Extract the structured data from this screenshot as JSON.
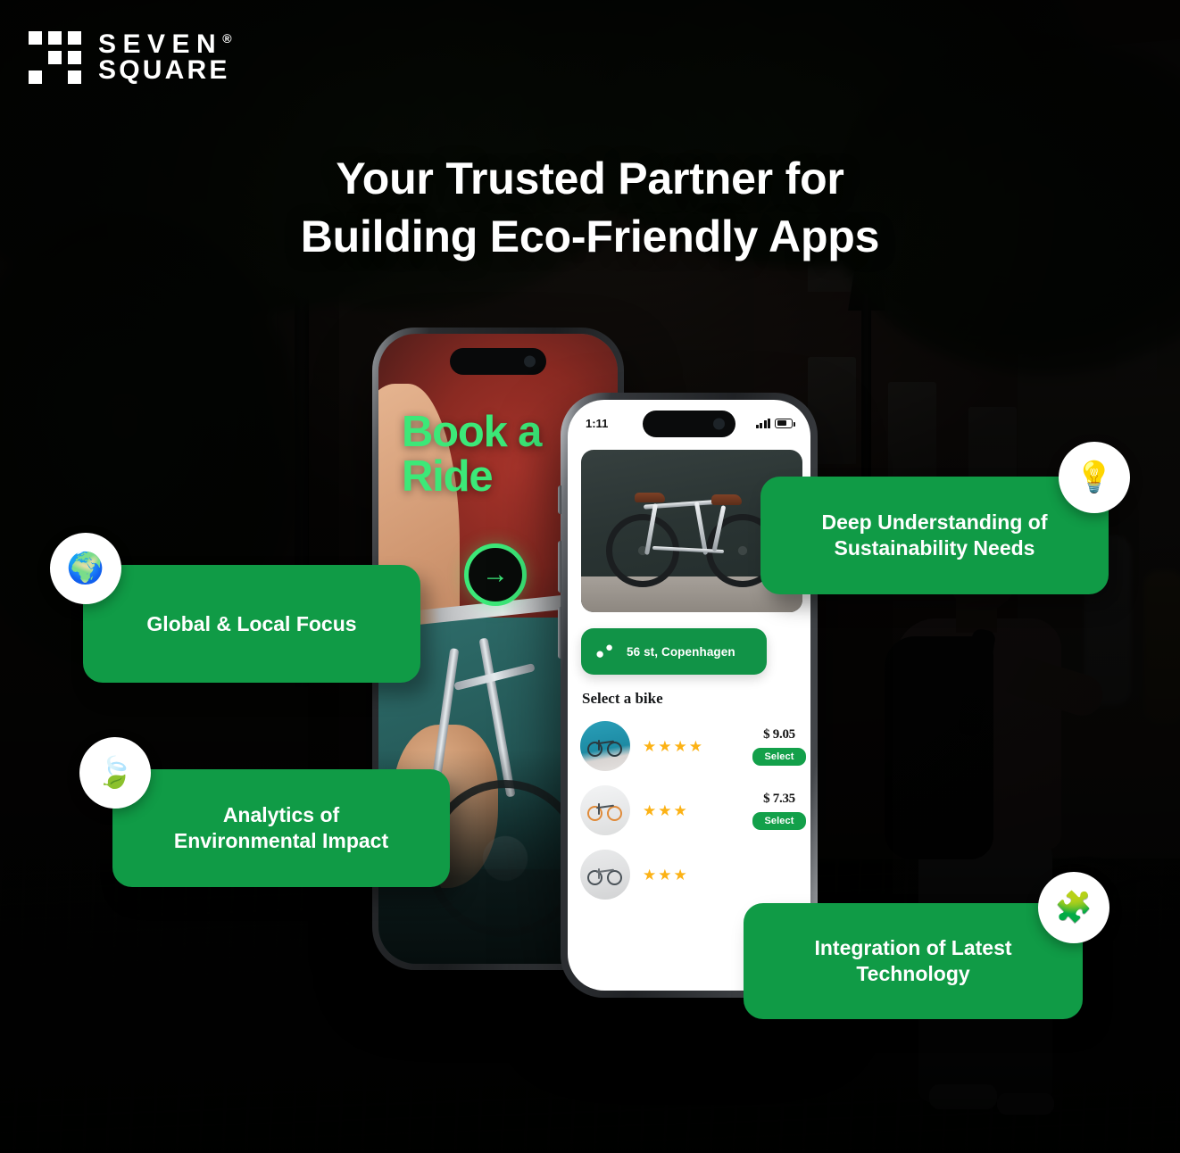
{
  "brand": {
    "logo_line1": "SEVEN",
    "logo_line2": "SQUARE",
    "registered_mark": "®",
    "logo_icon": "seven-square-grid-logo"
  },
  "headline": {
    "line1": "Your Trusted Partner for",
    "line2": "Building Eco-Friendly Apps"
  },
  "colors": {
    "brand_green": "#109B46",
    "card_green": "#119347",
    "select_green": "#13a04a",
    "neon_green": "#3ce878",
    "star_yellow": "#fcb215",
    "text_white": "#ffffff",
    "dark_bg": "#0b0c0a"
  },
  "feature_cards": [
    {
      "id": "global",
      "label": "Global & Local Focus",
      "icon": "globe-earth-icon",
      "glyph": "🌍"
    },
    {
      "id": "analytics",
      "label": "Analytics of\nEnvironmental Impact",
      "line1": "Analytics of",
      "line2": "Environmental Impact",
      "icon": "leaf-icon",
      "glyph": "🍃"
    },
    {
      "id": "deep",
      "label": "Deep Understanding of\nSustainability Needs",
      "line1": "Deep Understanding of",
      "line2": "Sustainability Needs",
      "icon": "lightbulb-idea-person-icon",
      "glyph": "💡"
    },
    {
      "id": "integration",
      "label": "Integration of Latest\nTechnology",
      "line1": "Integration of Latest",
      "line2": "Technology",
      "icon": "puzzle-pieces-icon",
      "glyph": "🧩"
    }
  ],
  "phone_back": {
    "headline_line1": "Book a",
    "headline_line2": "Ride",
    "arrow_glyph": "→",
    "arrow_name": "next-arrow-button"
  },
  "phone_front": {
    "status_bar": {
      "time": "1:11",
      "signal_icon": "cellular-signal-icon",
      "battery_icon": "battery-icon"
    },
    "hero_image_alt": "silver-road-bike-photo",
    "location": {
      "text": "56 st, Copenhagen",
      "icon": "map-pin-icon"
    },
    "section_title": "Select a bike",
    "bike_list": [
      {
        "thumb": "teal-wall-bike-thumb",
        "rating": 4,
        "price": "$ 9.05",
        "select_label": "Select"
      },
      {
        "thumb": "white-wall-orange-bike-thumb",
        "rating": 3,
        "price": "$ 7.35",
        "select_label": "Select"
      },
      {
        "thumb": "grey-wall-bike-thumb",
        "rating": 3,
        "price": "",
        "select_label": ""
      }
    ]
  }
}
